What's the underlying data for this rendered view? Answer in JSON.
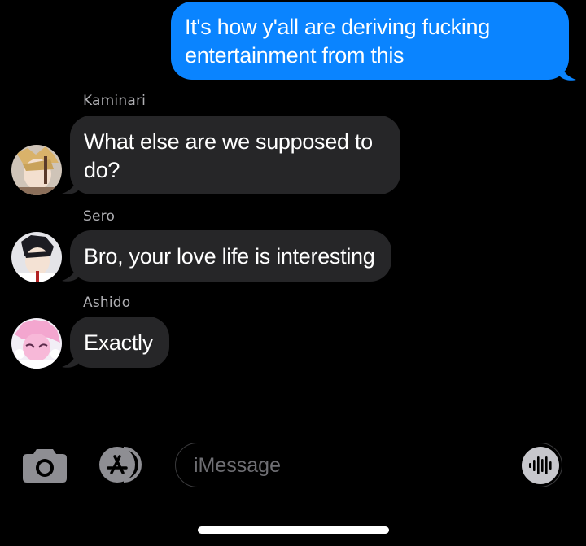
{
  "messages": {
    "outgoing": {
      "line1": "It's how y'all are deriving fucking",
      "line2": "entertainment from this"
    },
    "kaminari": {
      "sender": "Kaminari",
      "line1": "What else are we supposed to",
      "line2": "do?"
    },
    "sero": {
      "sender": "Sero",
      "text": "Bro, your love life is interesting"
    },
    "ashido": {
      "sender": "Ashido",
      "text": "Exactly"
    }
  },
  "compose": {
    "placeholder": "iMessage",
    "camera_icon": "camera-icon",
    "appstore_icon": "app-store-icon",
    "audio_icon": "waveform-icon"
  },
  "colors": {
    "outgoing_bubble": "#0a84ff",
    "incoming_bubble": "#262628",
    "background": "#000000"
  }
}
